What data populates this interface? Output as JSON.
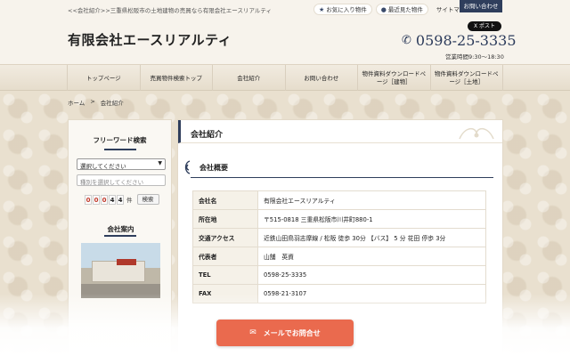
{
  "topbar": {
    "crumb": "<<会社紹介>>三重県松阪市の土地建物の売買なら有限会社エースリアルティ",
    "favorites": "お気に入り物件",
    "recent": "最近見た物件",
    "sitemap": "サイトマップ",
    "inquiry_tab": "お問い合わせ",
    "xpost": "X ポスト"
  },
  "header": {
    "title": "有限会社エースリアルティ",
    "phone": "0598-25-3335",
    "hours": "営業時間9:30～18:30"
  },
  "nav": [
    "トップページ",
    "売買物件検索トップ",
    "会社紹介",
    "お問い合わせ",
    "物件資料ダウンロードページ［建物］",
    "物件資料ダウンロードページ［土地］"
  ],
  "breadcrumb": {
    "home": "ホーム",
    "sep": ">",
    "current": "会社紹介"
  },
  "sidebar": {
    "freeword_title": "フリーワード検索",
    "select_value": "選択してください",
    "kind_placeholder": "種別を選択してください",
    "count_digits": [
      "0",
      "0",
      "0",
      "4",
      "4"
    ],
    "count_unit": "件",
    "search_label": "検索",
    "company_title": "会社案内"
  },
  "main": {
    "title": "会社紹介",
    "section_title": "会社概要",
    "rows": [
      {
        "k": "会社名",
        "v": "有限会社エースリアルティ"
      },
      {
        "k": "所在地",
        "v": "〒515-0818 三重県松阪市川井町880-1"
      },
      {
        "k": "交通アクセス",
        "v": "近鉄山田鳥羽志摩線 / 松阪 徒歩 30分 【バス】 5 分 花田 停歩 3分"
      },
      {
        "k": "代表者",
        "v": "山舗　英資"
      },
      {
        "k": "TEL",
        "v": "0598-25-3335"
      },
      {
        "k": "FAX",
        "v": "0598-21-3107"
      }
    ]
  },
  "mail_button": "メールでお問合せ",
  "colors": {
    "accent": "#2f3e5c",
    "cta": "#ea6a4e"
  }
}
